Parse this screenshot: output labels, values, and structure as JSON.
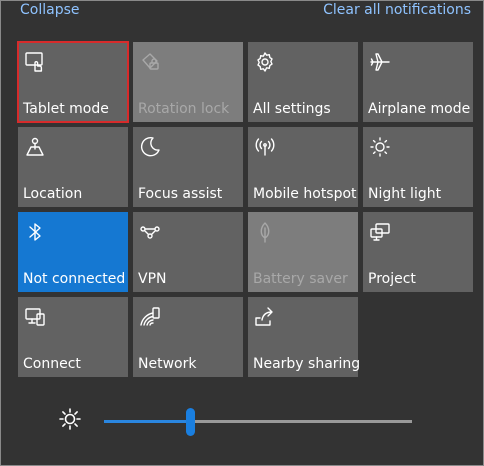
{
  "header": {
    "collapse_label": "Collapse",
    "clear_label": "Clear all notifications"
  },
  "tiles": [
    {
      "label": "Tablet mode",
      "icon": "tablet-mode-icon",
      "state": "selected"
    },
    {
      "label": "Rotation lock",
      "icon": "rotation-lock-icon",
      "state": "disabled"
    },
    {
      "label": "All settings",
      "icon": "gear-icon",
      "state": "normal"
    },
    {
      "label": "Airplane mode",
      "icon": "airplane-icon",
      "state": "normal"
    },
    {
      "label": "Location",
      "icon": "location-icon",
      "state": "normal"
    },
    {
      "label": "Focus assist",
      "icon": "moon-icon",
      "state": "normal"
    },
    {
      "label": "Mobile hotspot",
      "icon": "hotspot-icon",
      "state": "normal"
    },
    {
      "label": "Night light",
      "icon": "night-light-icon",
      "state": "normal"
    },
    {
      "label": "Not connected",
      "icon": "bluetooth-icon",
      "state": "active"
    },
    {
      "label": "VPN",
      "icon": "vpn-icon",
      "state": "normal"
    },
    {
      "label": "Battery saver",
      "icon": "leaf-icon",
      "state": "disabled"
    },
    {
      "label": "Project",
      "icon": "project-icon",
      "state": "normal"
    },
    {
      "label": "Connect",
      "icon": "connect-icon",
      "state": "normal"
    },
    {
      "label": "Network",
      "icon": "network-icon",
      "state": "normal"
    },
    {
      "label": "Nearby sharing",
      "icon": "share-icon",
      "state": "normal"
    }
  ],
  "brightness": {
    "icon": "brightness-icon",
    "level_percent": 28
  },
  "colors": {
    "panel": "#333333",
    "tile": "#626262",
    "active_tile": "#1578d2",
    "link": "#8fc3ff",
    "selection_outline": "#d72b2b"
  }
}
